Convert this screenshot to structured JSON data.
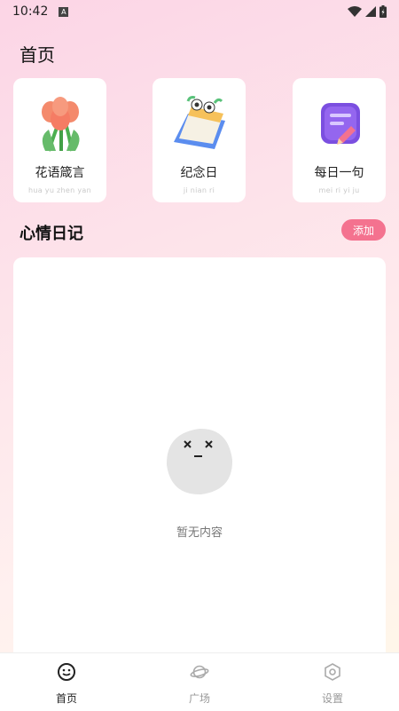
{
  "status_bar": {
    "time": "10:42",
    "indicator": "A"
  },
  "page_title": "首页",
  "cards": [
    {
      "title": "花语箴言",
      "subtitle": "hua yu zhen yan",
      "icon": "tulip-icon"
    },
    {
      "title": "纪念日",
      "subtitle": "ji nian ri",
      "icon": "calendar-icon"
    },
    {
      "title": "每日一句",
      "subtitle": "mei ri yi ju",
      "icon": "note-icon"
    }
  ],
  "diary": {
    "title": "心情日记",
    "add_label": "添加",
    "empty_text": "暂无内容"
  },
  "tabs": [
    {
      "label": "首页",
      "icon": "smile-icon",
      "active": true
    },
    {
      "label": "广场",
      "icon": "planet-icon",
      "active": false
    },
    {
      "label": "设置",
      "icon": "hexagon-settings-icon",
      "active": false
    }
  ],
  "colors": {
    "accent": "#f4728f"
  }
}
